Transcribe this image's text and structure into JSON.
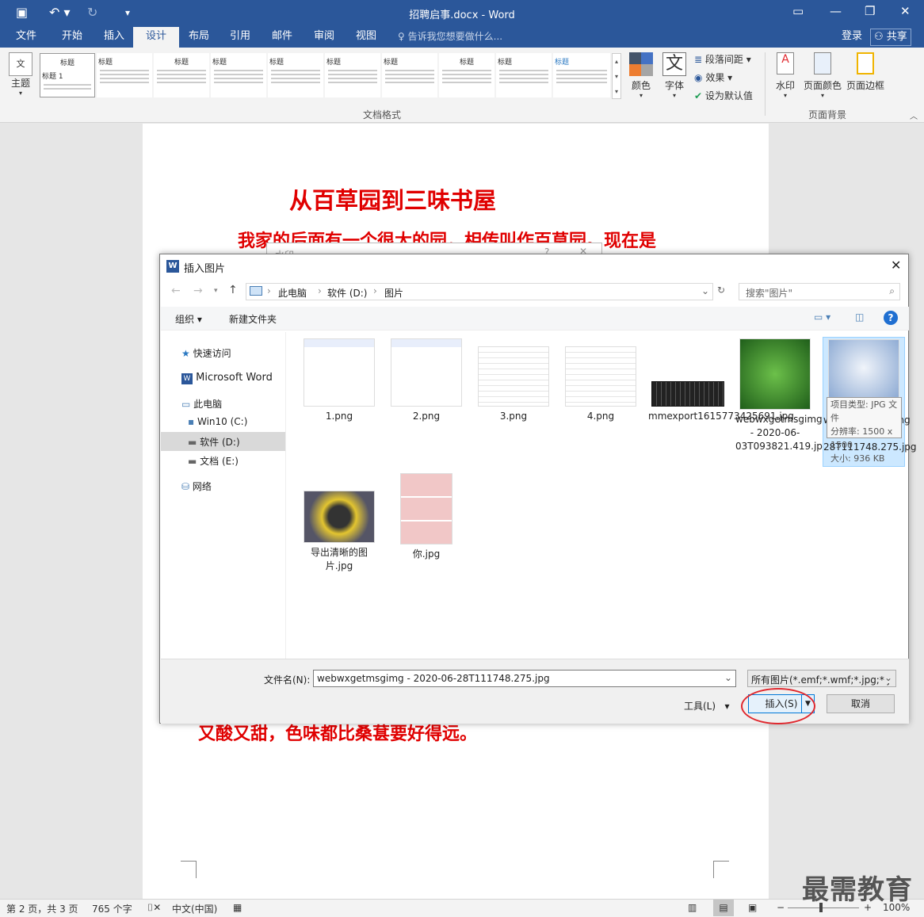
{
  "window": {
    "title": "招聘启事.docx - Word"
  },
  "tabs": [
    "文件",
    "开始",
    "插入",
    "设计",
    "布局",
    "引用",
    "邮件",
    "审阅",
    "视图"
  ],
  "tell_me": "告诉我您想要做什么...",
  "account": {
    "login": "登录",
    "share": "共享"
  },
  "ribbon": {
    "theme": "主题",
    "style_thumb_title": "标题",
    "style_thumb_heading1": "标题 1",
    "colors": "颜色",
    "fonts": "字体",
    "fonts_glyph": "文",
    "paragraph_spacing": "段落间距",
    "effects": "效果",
    "set_default": "设为默认值",
    "group_doc_format": "文档格式",
    "watermark": "水印",
    "page_color": "页面颜色",
    "page_border": "页面边框",
    "group_page_bg": "页面背景"
  },
  "document": {
    "heading": "从百草园到三味书屋",
    "line1": "我家的后面有一个很大的园，相传叫作百草园。现在是",
    "line_last": "又酸又甜，色味都比桑葚要好得远。"
  },
  "bg_dialog": {
    "title": "水印",
    "q": "?"
  },
  "dialog": {
    "title": "插入图片",
    "path": [
      "此电脑",
      "软件 (D:)",
      "图片"
    ],
    "search_placeholder": "搜索\"图片\"",
    "organize": "组织",
    "new_folder": "新建文件夹",
    "nav": [
      "快速访问",
      "Microsoft Word",
      "此电脑",
      "Win10 (C:)",
      "软件 (D:)",
      "文档 (E:)",
      "网络"
    ],
    "files": [
      "1.png",
      "2.png",
      "3.png",
      "4.png",
      "mmexport1615773425691.jpg",
      "webwxgetmsgimg - 2020-06-03T093821.419.jpg",
      "webwxgetmsgimg - 2020-06-28T111748.275.jpg",
      "导出清晰的图片.jpg",
      "你.jpg"
    ],
    "tooltip": [
      "项目类型: JPG 文件",
      "分辨率: 1500 x 1500",
      "大小: 936 KB"
    ],
    "filename_label": "文件名(N):",
    "filename": "webwxgetmsgimg - 2020-06-28T111748.275.jpg",
    "filter": "所有图片(*.emf;*.wmf;*.jpg;*.j",
    "tools": "工具(L)",
    "insert": "插入(S)",
    "cancel": "取消"
  },
  "status": {
    "page": "第 2 页，共 3 页",
    "words": "765 个字",
    "lang": "中文(中国)",
    "zoom": "100%"
  },
  "watermark_text": "最需教育",
  "colors": {
    "word_blue": "#2b579a",
    "doc_red": "#e00000",
    "highlight": "#cce8ff",
    "annotation": "#e0282e"
  }
}
